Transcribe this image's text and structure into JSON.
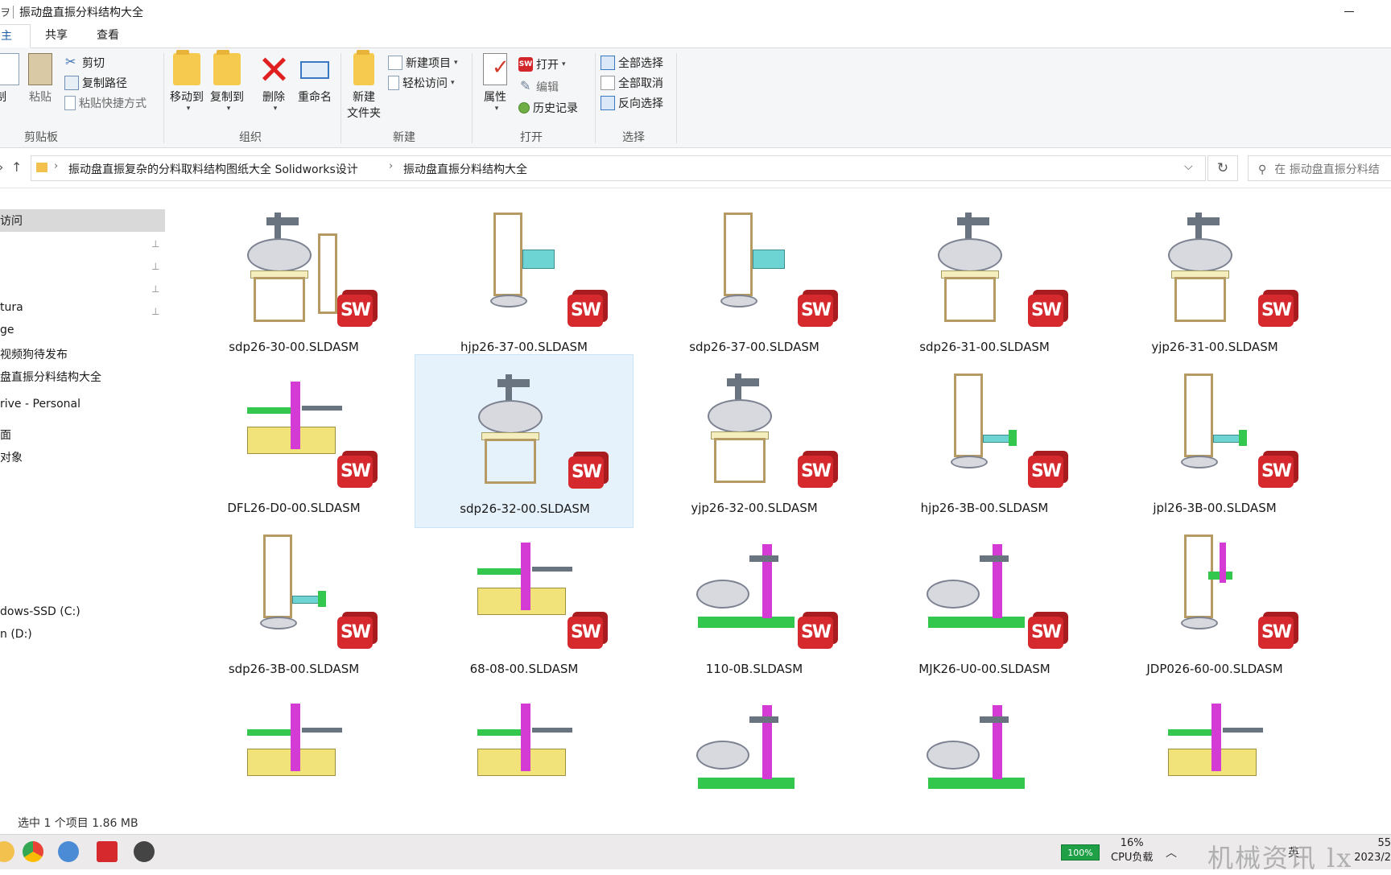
{
  "window": {
    "quick_access": "ヲ",
    "title": "振动盘直振分料结构大全"
  },
  "tabs": [
    {
      "label": "主页"
    },
    {
      "label": "共享"
    },
    {
      "label": "查看"
    }
  ],
  "ribbon": {
    "clipboard": {
      "copy": "制",
      "paste": "粘贴",
      "cut": "剪切",
      "copy_path": "复制路径",
      "paste_shortcut": "粘贴快捷方式",
      "group": "剪贴板"
    },
    "organize": {
      "move_to": "移动到",
      "copy_to": "复制到",
      "delete": "删除",
      "rename": "重命名",
      "group": "组织"
    },
    "new": {
      "new_folder_line1": "新建",
      "new_folder_line2": "文件夹",
      "new_item": "新建项目",
      "easy_access": "轻松访问",
      "group": "新建"
    },
    "open": {
      "properties": "属性",
      "open": "打开",
      "edit": "编辑",
      "history": "历史记录",
      "group": "打开"
    },
    "select": {
      "select_all": "全部选择",
      "select_none": "全部取消",
      "invert": "反向选择",
      "group": "选择"
    }
  },
  "address": {
    "crumbs": [
      "振动盘直振复杂的分料取料结构图纸大全 Solidworks设计",
      "振动盘直振分料结构大全"
    ],
    "search_placeholder": "在 振动盘直振分料结"
  },
  "sidebar": {
    "quick_access": "访问",
    "items": [
      "tura",
      "ge",
      "视频狗待发布",
      "盘直振分料结构大全",
      "rive - Personal",
      "面",
      "对象",
      "dows-SSD (C:)",
      "n (D:)"
    ]
  },
  "files": [
    {
      "name": "sdp26-30-00.SLDASM",
      "kind": "bowl-tower"
    },
    {
      "name": "hjp26-37-00.SLDASM",
      "kind": "tower-teal"
    },
    {
      "name": "sdp26-37-00.SLDASM",
      "kind": "tower-teal"
    },
    {
      "name": "sdp26-31-00.SLDASM",
      "kind": "bowl"
    },
    {
      "name": "yjp26-31-00.SLDASM",
      "kind": "bowl"
    },
    {
      "name": "DFL26-D0-00.SLDASM",
      "kind": "magenta"
    },
    {
      "name": "sdp26-32-00.SLDASM",
      "kind": "bowl",
      "selected": true
    },
    {
      "name": "yjp26-32-00.SLDASM",
      "kind": "bowl"
    },
    {
      "name": "hjp26-3B-00.SLDASM",
      "kind": "tower"
    },
    {
      "name": "jpl26-3B-00.SLDASM",
      "kind": "tower"
    },
    {
      "name": "sdp26-3B-00.SLDASM",
      "kind": "tower"
    },
    {
      "name": "68-08-00.SLDASM",
      "kind": "magenta"
    },
    {
      "name": "110-0B.SLDASM",
      "kind": "color-bowl"
    },
    {
      "name": "MJK26-U0-00.SLDASM",
      "kind": "color-bowl"
    },
    {
      "name": "JDP026-60-00.SLDASM",
      "kind": "tower-color"
    }
  ],
  "sw_badge": "SW",
  "status": {
    "selection": "选中 1 个项目  1.86 MB"
  },
  "taskbar": {
    "battery": "100%",
    "cpu_percent": "16%",
    "cpu_label": "CPU负载",
    "tray_lang": "英",
    "watermark": "机械资讯 lx",
    "clock_time": "55",
    "clock_date": "2023/2"
  },
  "colors": {
    "accent": "#1c5fa8",
    "selection_bg": "#e5f1fb",
    "sw_red": "#d5292e"
  }
}
